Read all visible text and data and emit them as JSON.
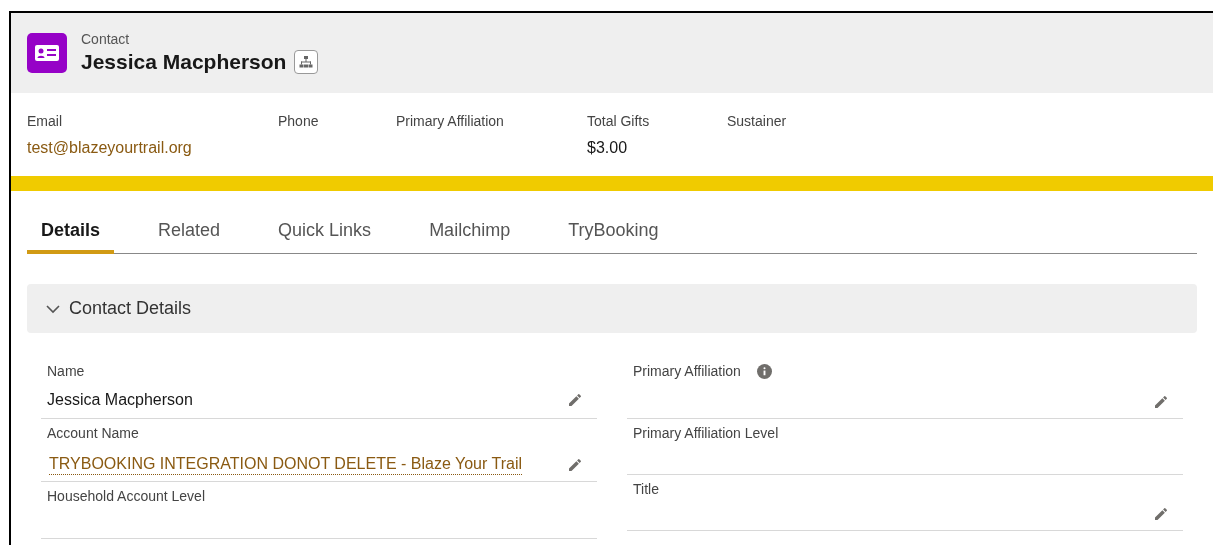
{
  "header": {
    "object_type": "Contact",
    "title": "Jessica Macpherson"
  },
  "highlights": [
    {
      "label": "Email",
      "value": "test@blazeyourtrail.org",
      "kind": "link"
    },
    {
      "label": "Phone"
    },
    {
      "label": "Primary Affiliation"
    },
    {
      "label": "Total Gifts",
      "value": "$3.00",
      "kind": "text"
    },
    {
      "label": "Sustainer"
    }
  ],
  "tabs": [
    {
      "label": "Details",
      "selected": true
    },
    {
      "label": "Related",
      "selected": false
    },
    {
      "label": "Quick Links",
      "selected": false
    },
    {
      "label": "Mailchimp",
      "selected": false
    },
    {
      "label": "TryBooking",
      "selected": false
    }
  ],
  "section": {
    "title": "Contact Details",
    "expanded": true
  },
  "left_fields": [
    {
      "label": "Name",
      "value": "Jessica Macpherson",
      "kind": "text",
      "editable": true,
      "info": false
    },
    {
      "label": "Account Name",
      "value": "TRYBOOKING INTEGRATION DONOT DELETE - Blaze Your Trail",
      "kind": "link",
      "editable": true,
      "info": false
    },
    {
      "label": "Household Account Level",
      "editable": false,
      "info": false
    }
  ],
  "right_fields": [
    {
      "label": "Primary Affiliation",
      "editable": true,
      "info": true
    },
    {
      "label": "Primary Affiliation Level",
      "editable": false,
      "info": false
    },
    {
      "label": "Title",
      "editable": true,
      "info": false
    }
  ]
}
